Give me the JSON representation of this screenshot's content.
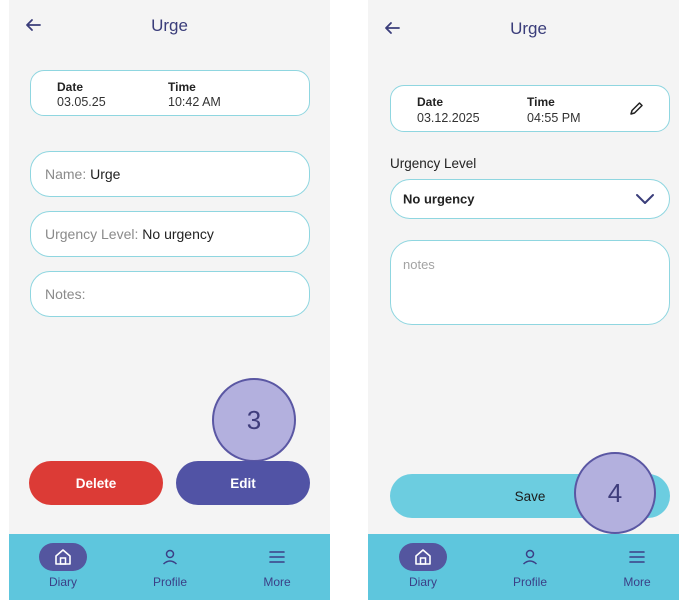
{
  "screen1": {
    "title": "Urge",
    "date_label": "Date",
    "date_value": "03.05.25",
    "time_label": "Time",
    "time_value": "10:42 AM",
    "name_label": "Name: ",
    "name_value": "Urge",
    "urgency_label": "Urgency Level: ",
    "urgency_value": "No urgency",
    "notes_label": "Notes:",
    "delete_label": "Delete",
    "edit_label": "Edit",
    "callout": "3"
  },
  "screen2": {
    "title": "Urge",
    "date_label": "Date",
    "date_value": "03.12.2025",
    "time_label": "Time",
    "time_value": "04:55 PM",
    "urgency_label": "Urgency Level",
    "urgency_value": "No urgency",
    "notes_placeholder": "notes",
    "save_label": "Save",
    "callout": "4"
  },
  "nav": {
    "items": [
      {
        "label": "Diary",
        "icon": "home-icon",
        "active": true
      },
      {
        "label": "Profile",
        "icon": "person-icon",
        "active": false
      },
      {
        "label": "More",
        "icon": "menu-icon",
        "active": false
      }
    ]
  },
  "colors": {
    "accent": "#5153a5",
    "delete": "#dc3b36",
    "navbar": "#5ec6dd",
    "field_border": "#8fd6e0"
  }
}
